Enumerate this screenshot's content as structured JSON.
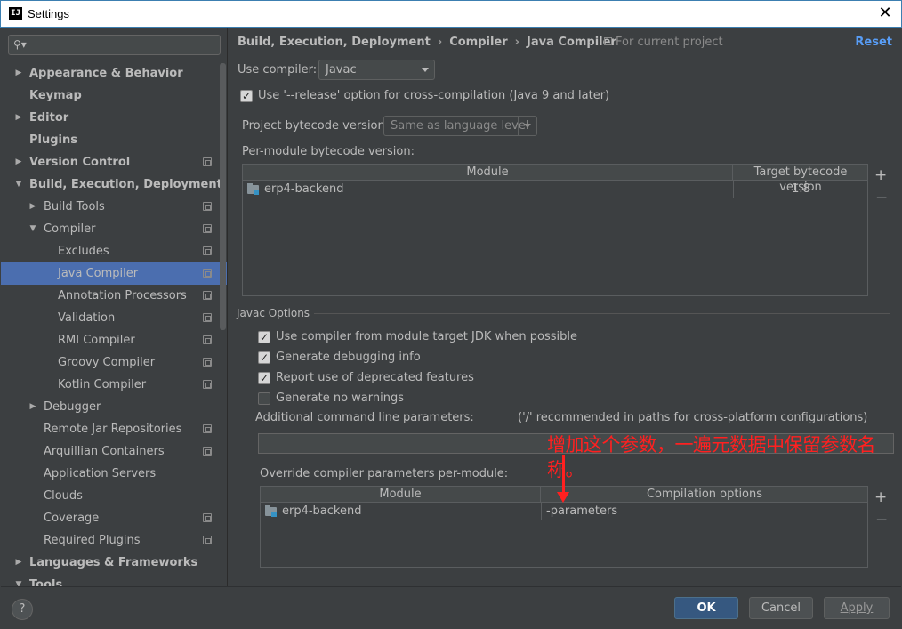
{
  "window": {
    "title": "Settings",
    "app_icon": "IJ",
    "close_glyph": "✕"
  },
  "sidebar": {
    "search_placeholder": "",
    "items": [
      {
        "label": "Appearance & Behavior",
        "level": 0,
        "bold": true,
        "arrow": "right",
        "proj": false
      },
      {
        "label": "Keymap",
        "level": 0,
        "bold": true,
        "arrow": "",
        "proj": false
      },
      {
        "label": "Editor",
        "level": 0,
        "bold": true,
        "arrow": "right",
        "proj": false
      },
      {
        "label": "Plugins",
        "level": 0,
        "bold": true,
        "arrow": "",
        "proj": false
      },
      {
        "label": "Version Control",
        "level": 0,
        "bold": true,
        "arrow": "right",
        "proj": true
      },
      {
        "label": "Build, Execution, Deployment",
        "level": 0,
        "bold": true,
        "arrow": "down",
        "proj": false
      },
      {
        "label": "Build Tools",
        "level": 1,
        "bold": false,
        "arrow": "right",
        "proj": true
      },
      {
        "label": "Compiler",
        "level": 1,
        "bold": false,
        "arrow": "down",
        "proj": true
      },
      {
        "label": "Excludes",
        "level": 2,
        "bold": false,
        "arrow": "",
        "proj": true
      },
      {
        "label": "Java Compiler",
        "level": 2,
        "bold": false,
        "arrow": "",
        "proj": true,
        "selected": true
      },
      {
        "label": "Annotation Processors",
        "level": 2,
        "bold": false,
        "arrow": "",
        "proj": true
      },
      {
        "label": "Validation",
        "level": 2,
        "bold": false,
        "arrow": "",
        "proj": true
      },
      {
        "label": "RMI Compiler",
        "level": 2,
        "bold": false,
        "arrow": "",
        "proj": true
      },
      {
        "label": "Groovy Compiler",
        "level": 2,
        "bold": false,
        "arrow": "",
        "proj": true
      },
      {
        "label": "Kotlin Compiler",
        "level": 2,
        "bold": false,
        "arrow": "",
        "proj": true
      },
      {
        "label": "Debugger",
        "level": 1,
        "bold": false,
        "arrow": "right",
        "proj": false
      },
      {
        "label": "Remote Jar Repositories",
        "level": 1,
        "bold": false,
        "arrow": "",
        "proj": true
      },
      {
        "label": "Arquillian Containers",
        "level": 1,
        "bold": false,
        "arrow": "",
        "proj": true
      },
      {
        "label": "Application Servers",
        "level": 1,
        "bold": false,
        "arrow": "",
        "proj": false
      },
      {
        "label": "Clouds",
        "level": 1,
        "bold": false,
        "arrow": "",
        "proj": false
      },
      {
        "label": "Coverage",
        "level": 1,
        "bold": false,
        "arrow": "",
        "proj": true
      },
      {
        "label": "Required Plugins",
        "level": 1,
        "bold": false,
        "arrow": "",
        "proj": true
      },
      {
        "label": "Languages & Frameworks",
        "level": 0,
        "bold": true,
        "arrow": "right",
        "proj": false
      },
      {
        "label": "Tools",
        "level": 0,
        "bold": true,
        "arrow": "down",
        "proj": false
      }
    ]
  },
  "breadcrumb": {
    "items": [
      "Build, Execution, Deployment",
      "Compiler",
      "Java Compiler"
    ],
    "separator": "›"
  },
  "for_current_project": "For current project",
  "reset_label": "Reset",
  "use_compiler": {
    "label": "Use compiler:",
    "value": "Javac"
  },
  "release_option": {
    "label": "Use '--release' option for cross-compilation (Java 9 and later)",
    "checked": true
  },
  "bytecode_version": {
    "label": "Project bytecode version:",
    "value": "Same as language level"
  },
  "per_module": {
    "label": "Per-module bytecode version:",
    "columns": [
      "Module",
      "Target bytecode version"
    ],
    "rows": [
      {
        "module": "erp4-backend",
        "version": "1.8"
      }
    ]
  },
  "javac_options": {
    "title": "Javac Options",
    "checkboxes": [
      {
        "label": "Use compiler from module target JDK when possible",
        "checked": true
      },
      {
        "label": "Generate debugging info",
        "checked": true
      },
      {
        "label": "Report use of deprecated features",
        "checked": true
      },
      {
        "label": "Generate no warnings",
        "checked": false
      }
    ],
    "additional_label": "Additional command line parameters:",
    "additional_hint": "('/' recommended in paths for cross-platform configurations)",
    "additional_value": ""
  },
  "override": {
    "label": "Override compiler parameters per-module:",
    "columns": [
      "Module",
      "Compilation options"
    ],
    "rows": [
      {
        "module": "erp4-backend",
        "options": "-parameters"
      }
    ]
  },
  "table_buttons": {
    "add": "+",
    "remove": "−"
  },
  "annotation": "增加这个参数，一遍元数据中保留参数名称。",
  "footer": {
    "help": "?",
    "ok": "OK",
    "cancel": "Cancel",
    "apply": "Apply"
  },
  "colors": {
    "selection": "#4b6eaf",
    "accent_link": "#589df6",
    "annotation": "#ff2020",
    "ok_button": "#365880"
  }
}
